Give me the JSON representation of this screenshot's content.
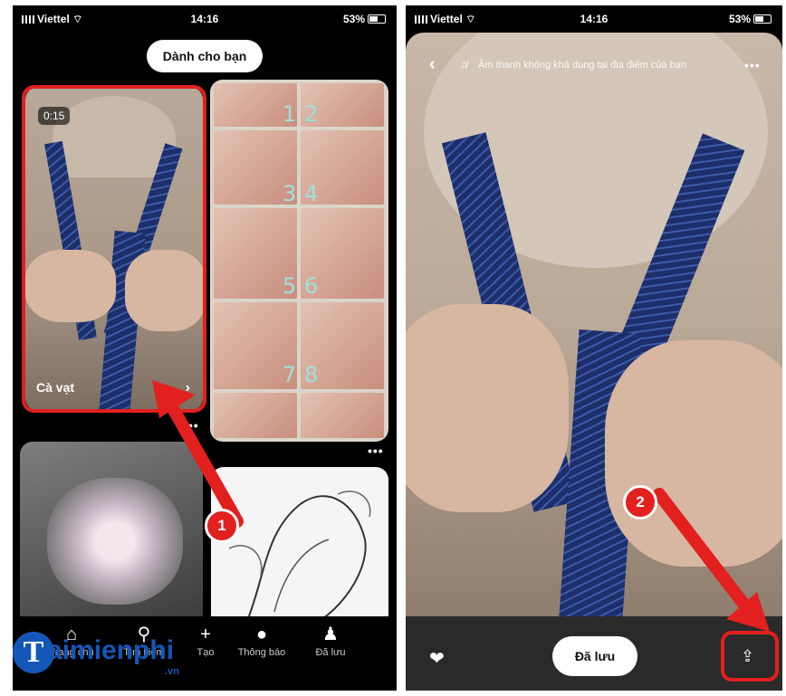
{
  "left_phone": {
    "status": {
      "carrier": "Viettel",
      "time": "14:16",
      "battery": "53%"
    },
    "top_pill": "Dành cho bạn",
    "pins": [
      {
        "badge": "0:15",
        "label": "Cà vạt"
      },
      {
        "steps": [
          "1",
          "2",
          "3",
          "4",
          "5",
          "6",
          "7",
          "8"
        ]
      }
    ],
    "nav": [
      {
        "icon": "home-icon",
        "label": "Trang chủ"
      },
      {
        "icon": "search-icon",
        "label": "Tìm kiếm"
      },
      {
        "icon": "plus-icon",
        "label": "Tạo"
      },
      {
        "icon": "chat-icon",
        "label": "Thông báo"
      },
      {
        "icon": "person-icon",
        "label": "Đã lưu"
      }
    ],
    "callout": "1"
  },
  "right_phone": {
    "status": {
      "carrier": "Viettel",
      "time": "14:16",
      "battery": "53%"
    },
    "header_text": "Âm thanh không khả dụng tại địa điểm của bạn",
    "saved_button": "Đã lưu",
    "callout": "2"
  },
  "watermark": {
    "brand": "aimienphi",
    "brand_initial": "T",
    "domain": ".vn"
  },
  "colors": {
    "highlight": "#e2201f",
    "brand": "#1557b8"
  }
}
